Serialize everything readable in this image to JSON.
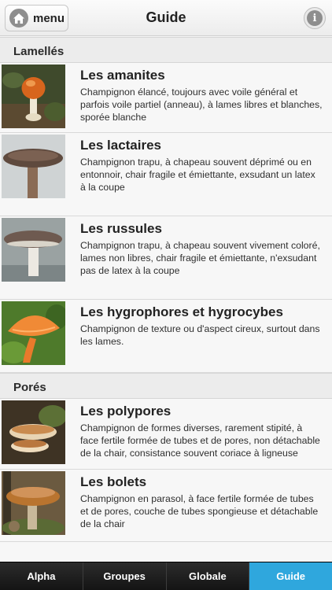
{
  "navbar": {
    "menu_label": "menu",
    "title": "Guide",
    "home_icon": "home-icon",
    "info_icon": "info-icon",
    "info_glyph": "i"
  },
  "sections": [
    {
      "header": "Lamellés",
      "items": [
        {
          "title": "Les amanites",
          "description": "Champignon élancé, toujours avec voile général et parfois voile partiel (anneau), à lames libres et blanches, sporée blanche"
        },
        {
          "title": "Les lactaires",
          "description": "Champignon trapu, à chapeau souvent déprimé ou en entonnoir, chair fragile et émiettante, exsudant un latex à la coupe"
        },
        {
          "title": "Les russules",
          "description": "Champignon trapu, à chapeau souvent vivement coloré, lames non libres, chair fragile et émiettante, n'exsudant pas de latex à la coupe"
        },
        {
          "title": "Les hygrophores et hygrocybes",
          "description": "Champignon de texture ou d'aspect cireux, surtout dans les lames."
        }
      ]
    },
    {
      "header": "Porés",
      "items": [
        {
          "title": "Les polypores",
          "description": "Champignon de formes diverses, rarement stipité, à face fertile formée de tubes et de pores, non détachable de la chair, consistance souvent coriace à ligneuse"
        },
        {
          "title": "Les bolets",
          "description": "Champignon en parasol, à face fertile formée de tubes et de pores, couche de tubes spongieuse et détachable de la chair"
        }
      ]
    }
  ],
  "tabbar": {
    "tabs": [
      {
        "label": "Alpha"
      },
      {
        "label": "Groupes"
      },
      {
        "label": "Globale"
      },
      {
        "label": "Guide"
      }
    ],
    "active_tab": "Guide",
    "active_color": "#2fa7dd"
  }
}
